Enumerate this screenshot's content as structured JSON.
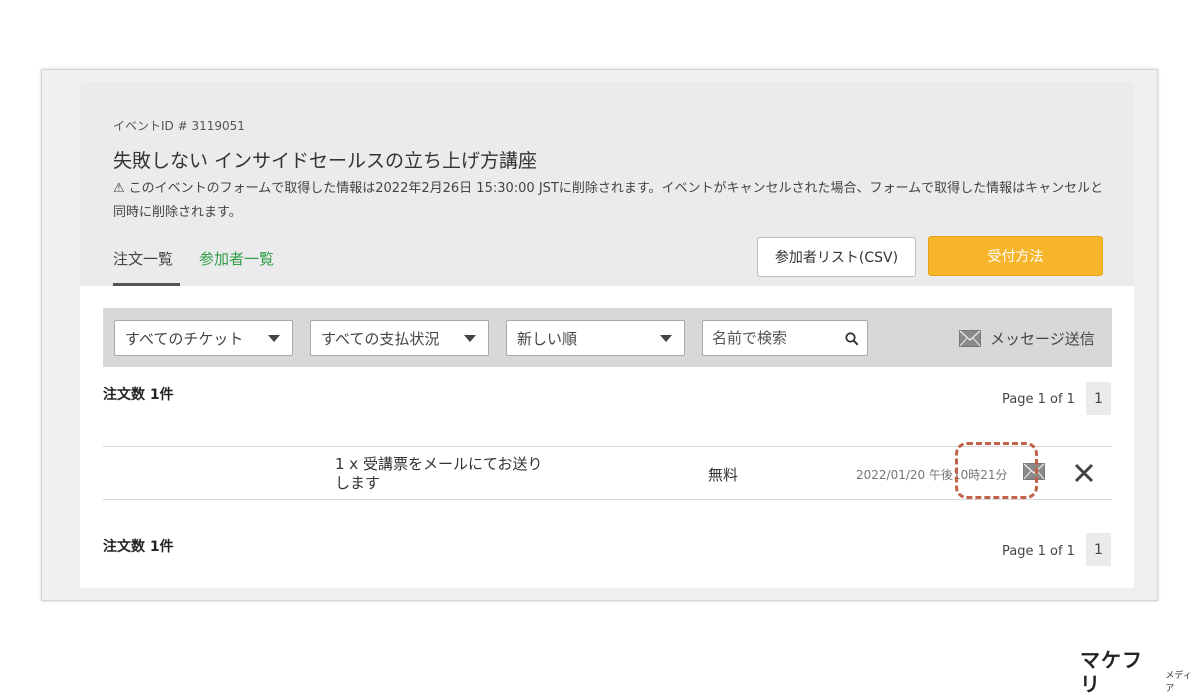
{
  "header": {
    "event_id": "イベントID # 3119051",
    "title": "失敗しない インサイドセールスの立ち上げ方講座",
    "notice": "このイベントのフォームで取得した情報は2022年2月26日 15:30:00 JSTに削除されます。イベントがキャンセルされた場合、フォームで取得した情報はキャンセルと同時に削除されます。",
    "warning_glyph": "⚠"
  },
  "tabs": [
    {
      "label": "注文一覧",
      "active": true
    },
    {
      "label": "参加者一覧",
      "active": false
    }
  ],
  "buttons": {
    "csv": "参加者リスト(CSV)",
    "reception": "受付方法"
  },
  "filters": {
    "ticket": "すべてのチケット",
    "payment": "すべての支払状況",
    "sort": "新しい順",
    "search_placeholder": "名前で検索",
    "message_send": "メッセージ送信"
  },
  "orders": {
    "count_label": "注文数 1件",
    "pagination_text": "Page 1 of 1",
    "page_number": "1",
    "rows": [
      {
        "ticket": "1 x 受講票をメールにてお送りします",
        "price": "無料",
        "date": "2022/01/20 午後10時21分"
      }
    ]
  },
  "colors": {
    "accent_green": "#2f9e44",
    "reception_button": "#f7b52c",
    "highlight_dashed": "#c0634a"
  },
  "brand": {
    "name": "マケフリ",
    "sub": "メディア"
  }
}
